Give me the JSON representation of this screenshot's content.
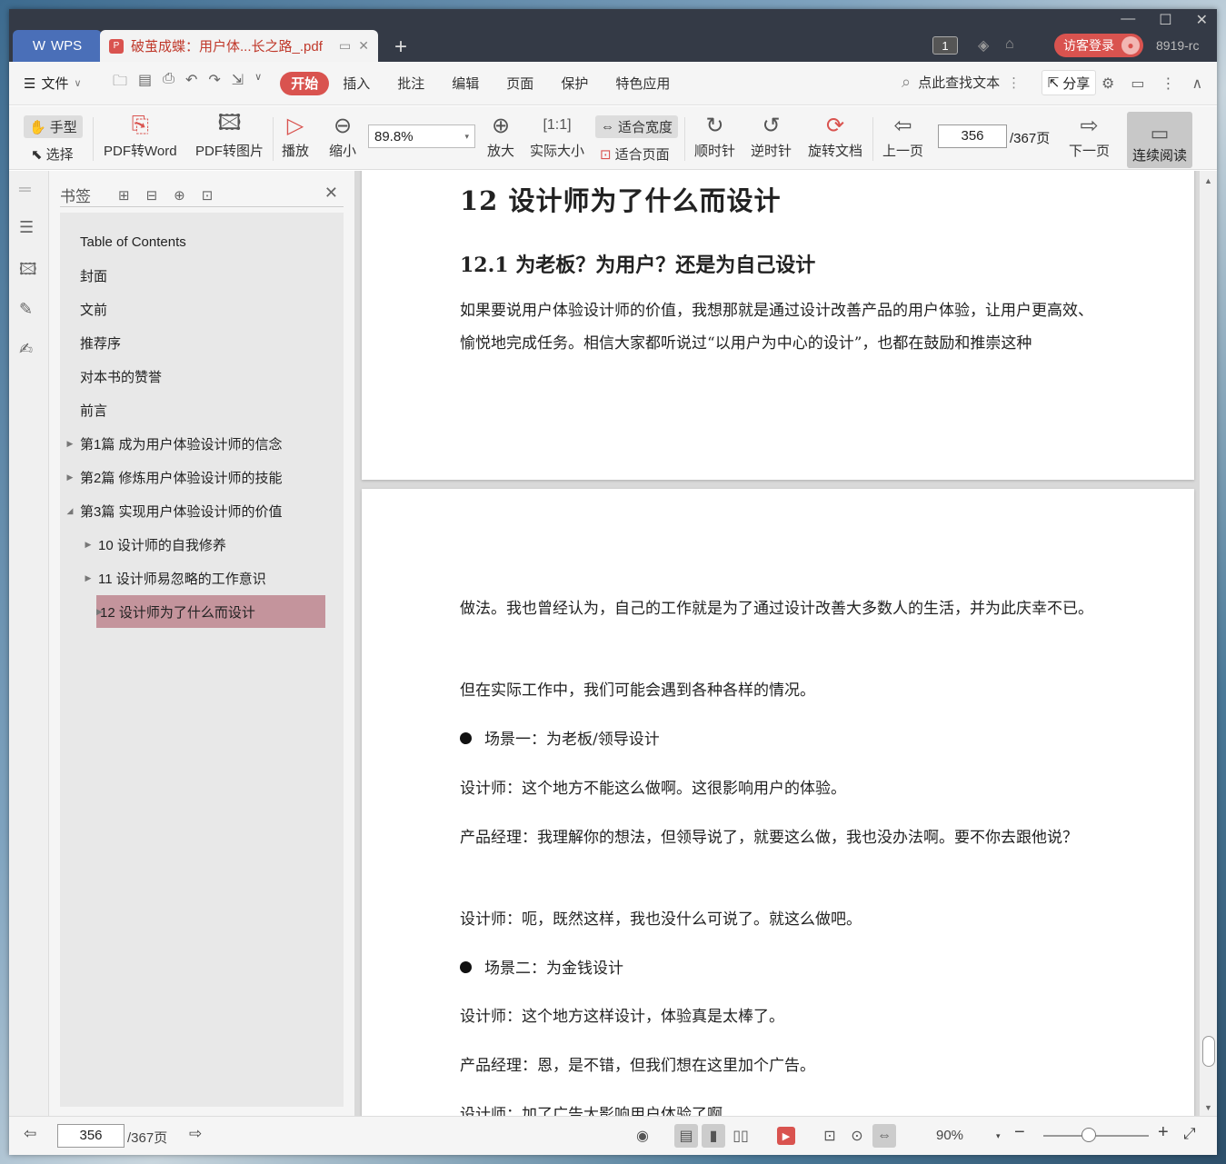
{
  "titlebar": {
    "app_label": "WPS",
    "doc_tab_title": "破茧成蝶：用户体...长之路_.pdf",
    "doc_badge_count": "1",
    "login_label": "访客登录",
    "user_id": "8919-rc"
  },
  "menubar": {
    "file_label": "文件",
    "tabs": [
      "开始",
      "插入",
      "批注",
      "编辑",
      "页面",
      "保护",
      "特色应用"
    ],
    "active_tab": "开始",
    "search_label": "点此查找文本",
    "share_label": "分享"
  },
  "toolbar": {
    "hand_label": "手型",
    "select_label": "选择",
    "pdf_to_word": "PDF转Word",
    "pdf_to_image": "PDF转图片",
    "play_label": "播放",
    "zoom_out_label": "缩小",
    "zoom_value": "89.8%",
    "zoom_in_label": "放大",
    "actual_size_label": "实际大小",
    "fit_width_label": "适合宽度",
    "fit_page_label": "适合页面",
    "clockwise_label": "顺时针",
    "counter_clockwise_label": "逆时针",
    "rotate_doc_label": "旋转文档",
    "prev_page_label": "上一页",
    "current_page": "356",
    "total_pages": "/367页",
    "next_page_label": "下一页",
    "continuous_label": "连续阅读"
  },
  "bookmarks": {
    "title": "书签",
    "items": [
      {
        "label": "Table of Contents",
        "level": 0,
        "arrow": ""
      },
      {
        "label": "封面",
        "level": 0,
        "arrow": ""
      },
      {
        "label": "文前",
        "level": 0,
        "arrow": ""
      },
      {
        "label": "推荐序",
        "level": 0,
        "arrow": ""
      },
      {
        "label": "对本书的赞誉",
        "level": 0,
        "arrow": ""
      },
      {
        "label": "前言",
        "level": 0,
        "arrow": ""
      },
      {
        "label": "第1篇 成为用户体验设计师的信念",
        "level": 0,
        "arrow": "▶"
      },
      {
        "label": "第2篇 修炼用户体验设计师的技能",
        "level": 0,
        "arrow": "▶"
      },
      {
        "label": "第3篇 实现用户体验设计师的价值",
        "level": 0,
        "arrow": "◢"
      },
      {
        "label": "10 设计师的自我修养",
        "level": 1,
        "arrow": "▶"
      },
      {
        "label": "11 设计师易忽略的工作意识",
        "level": 1,
        "arrow": "▶"
      },
      {
        "label": "12 设计师为了什么而设计",
        "level": 1,
        "arrow": "▶",
        "selected": true
      }
    ]
  },
  "document": {
    "chapter_title": "12  设计师为了什么而设计",
    "section_title": "12.1  为老板？为用户？还是为自己设计",
    "page1_para": "如果要说用户体验设计师的价值，我想那就是通过设计改善产品的用户体验，让用户更高效、愉悦地完成任务。相信大家都听说过“以用户为中心的设计”，也都在鼓励和推崇这种",
    "page2_paras": [
      "做法。我也曾经认为，自己的工作就是为了通过设计改善大多数人的生活，并为此庆幸不已。",
      "但在实际工作中，我们可能会遇到各种各样的情况。",
      "场景一：为老板/领导设计",
      "设计师：这个地方不能这么做啊。这很影响用户的体验。",
      "产品经理：我理解你的想法，但领导说了，就要这么做，我也没办法啊。要不你去跟他说？",
      "设计师：呃，既然这样，我也没什么可说了。就这么做吧。",
      "场景二：为金钱设计",
      "设计师：这个地方这样设计，体验真是太棒了。",
      "产品经理：恩，是不错，但我们想在这里加个广告。",
      "设计师：加了广告太影响用户体验了啊"
    ]
  },
  "statusbar": {
    "current_page": "356",
    "total_pages": "/367页",
    "zoom_percent": "90%"
  }
}
